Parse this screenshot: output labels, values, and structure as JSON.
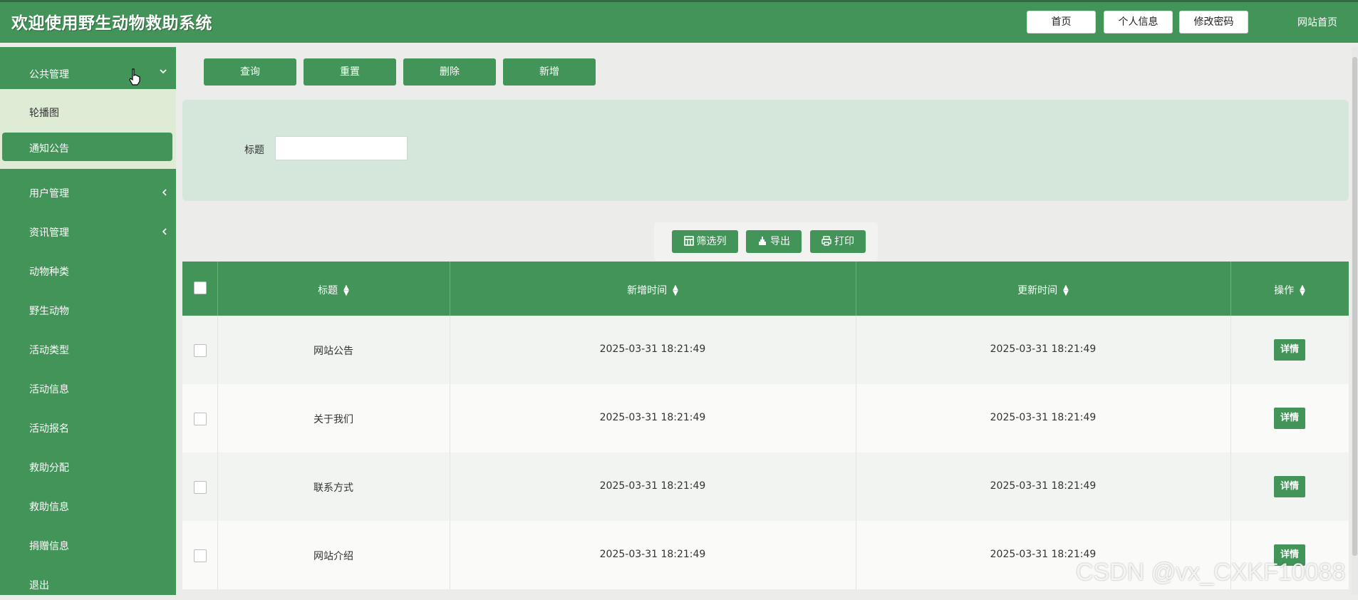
{
  "header": {
    "title": "欢迎使用野生动物救助系统",
    "buttons": [
      "首页",
      "个人信息",
      "修改密码"
    ],
    "site_home": "网站首页"
  },
  "sidebar": {
    "group": {
      "label": "公共管理",
      "expanded": true
    },
    "submenu": [
      {
        "label": "轮播图",
        "active": false
      },
      {
        "label": "通知公告",
        "active": true
      }
    ],
    "items": [
      {
        "label": "用户管理",
        "chevron": "chevron-left-icon"
      },
      {
        "label": "资讯管理",
        "chevron": "chevron-left-icon"
      },
      {
        "label": "动物种类"
      },
      {
        "label": "野生动物"
      },
      {
        "label": "活动类型"
      },
      {
        "label": "活动信息"
      },
      {
        "label": "活动报名"
      },
      {
        "label": "救助分配"
      },
      {
        "label": "救助信息"
      },
      {
        "label": "捐赠信息"
      },
      {
        "label": "退出"
      }
    ]
  },
  "toolbar": {
    "query": "查询",
    "reset": "重置",
    "delete": "删除",
    "add": "新增"
  },
  "search": {
    "title_label": "标题",
    "title_value": ""
  },
  "table_tools": {
    "filter_columns": "筛选列",
    "export": "导出",
    "print": "打印"
  },
  "table": {
    "headers": [
      "标题",
      "新增时间",
      "更新时间",
      "操作"
    ],
    "rows": [
      {
        "title": "网站公告",
        "created": "2025-03-31 18:21:49",
        "updated": "2025-03-31 18:21:49",
        "action": "详情"
      },
      {
        "title": "关于我们",
        "created": "2025-03-31 18:21:49",
        "updated": "2025-03-31 18:21:49",
        "action": "详情"
      },
      {
        "title": "联系方式",
        "created": "2025-03-31 18:21:49",
        "updated": "2025-03-31 18:21:49",
        "action": "详情"
      },
      {
        "title": "网站介绍",
        "created": "2025-03-31 18:21:49",
        "updated": "2025-03-31 18:21:49",
        "action": "详情"
      }
    ]
  },
  "watermark": "CSDN @vx_CXKF10088",
  "colors": {
    "primary": "#439458",
    "panel": "#d5e6db",
    "submenu_bg": "#deebd5"
  }
}
